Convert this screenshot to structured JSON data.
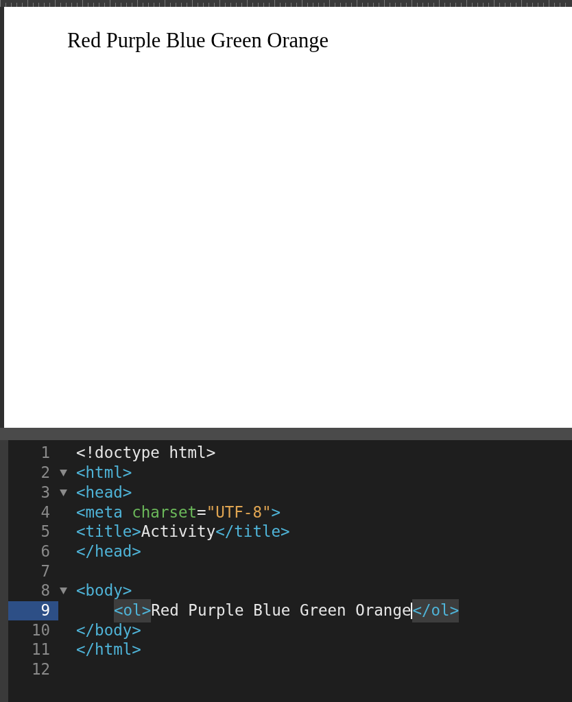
{
  "preview": {
    "text": "Red Purple Blue Green Orange"
  },
  "editor": {
    "lines": [
      {
        "number": "1",
        "foldable": false,
        "selected": false,
        "tokens": [
          {
            "kind": "text",
            "text": "<!doctype html>"
          }
        ]
      },
      {
        "number": "2",
        "foldable": true,
        "selected": false,
        "tokens": [
          {
            "kind": "tag",
            "text": "<html>"
          }
        ]
      },
      {
        "number": "3",
        "foldable": true,
        "selected": false,
        "tokens": [
          {
            "kind": "tag",
            "text": "<head>"
          }
        ]
      },
      {
        "number": "4",
        "foldable": false,
        "selected": false,
        "tokens": [
          {
            "kind": "tag",
            "text": "<meta "
          },
          {
            "kind": "attr",
            "text": "charset"
          },
          {
            "kind": "text",
            "text": "="
          },
          {
            "kind": "string",
            "text": "\"UTF-8\""
          },
          {
            "kind": "tag",
            "text": ">"
          }
        ]
      },
      {
        "number": "5",
        "foldable": false,
        "selected": false,
        "tokens": [
          {
            "kind": "tag",
            "text": "<title>"
          },
          {
            "kind": "text",
            "text": "Activity"
          },
          {
            "kind": "tag",
            "text": "</title>"
          }
        ]
      },
      {
        "number": "6",
        "foldable": false,
        "selected": false,
        "tokens": [
          {
            "kind": "tag",
            "text": "</head>"
          }
        ]
      },
      {
        "number": "7",
        "foldable": false,
        "selected": false
      },
      {
        "number": "8",
        "foldable": true,
        "selected": false,
        "tokens": [
          {
            "kind": "tag",
            "text": "<body>"
          }
        ]
      },
      {
        "number": "9",
        "foldable": false,
        "selected": true,
        "indented": true,
        "tokens": [
          {
            "kind": "tag",
            "text": "<ol>",
            "matched": true
          },
          {
            "kind": "text",
            "text": "Red Purple Blue Green Orange",
            "caret": true
          },
          {
            "kind": "tag",
            "text": "</ol>",
            "matched": true
          }
        ]
      },
      {
        "number": "10",
        "foldable": false,
        "selected": false,
        "tokens": [
          {
            "kind": "tag",
            "text": "</body>"
          }
        ]
      },
      {
        "number": "11",
        "foldable": false,
        "selected": false,
        "tokens": [
          {
            "kind": "tag",
            "text": "</html>"
          }
        ]
      },
      {
        "number": "12",
        "foldable": false,
        "selected": false
      }
    ]
  }
}
